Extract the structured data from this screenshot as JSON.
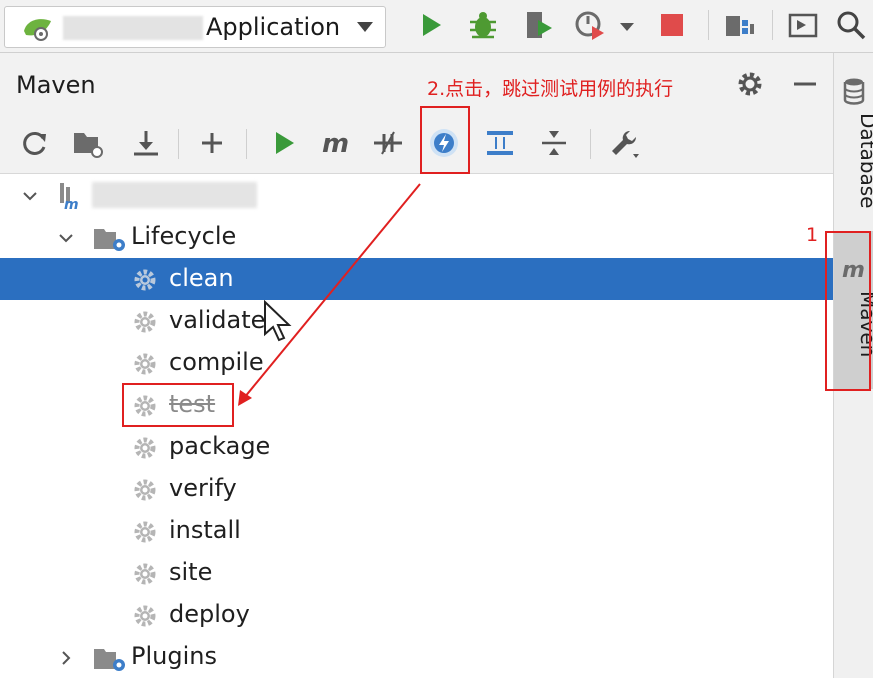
{
  "toolbar": {
    "run_config_name": "Application",
    "icons": [
      "spring-boot-icon",
      "run-icon",
      "debug-icon",
      "coverage-icon",
      "profile-icon",
      "dropdown-icon",
      "stop-icon",
      "project-structure-icon",
      "terminal-icon",
      "search-icon"
    ],
    "colors": {
      "run": "#3a9a3a",
      "debug": "#4e9a32",
      "stop": "#e04b4b"
    }
  },
  "panel": {
    "title": "Maven",
    "header_icons": [
      "gear-icon",
      "minimize-icon"
    ],
    "tools": [
      "reload-icon",
      "add-folder-icon",
      "download-icon",
      "plus-icon",
      "run-maven-icon",
      "execute-goal-icon",
      "toggle-offline-icon",
      "skip-tests-icon",
      "show-dependencies-icon",
      "collapse-all-icon",
      "settings-wrench-icon"
    ]
  },
  "tree": {
    "lifecycle_label": "Lifecycle",
    "plugins_label": "Plugins",
    "goals": [
      {
        "label": "clean",
        "selected": true,
        "skipped": false
      },
      {
        "label": "validate",
        "selected": false,
        "skipped": false
      },
      {
        "label": "compile",
        "selected": false,
        "skipped": false
      },
      {
        "label": "test",
        "selected": false,
        "skipped": true
      },
      {
        "label": "package",
        "selected": false,
        "skipped": false
      },
      {
        "label": "verify",
        "selected": false,
        "skipped": false
      },
      {
        "label": "install",
        "selected": false,
        "skipped": false
      },
      {
        "label": "site",
        "selected": false,
        "skipped": false
      },
      {
        "label": "deploy",
        "selected": false,
        "skipped": false
      }
    ],
    "selection_color": "#2b6fc0"
  },
  "right_strip": {
    "database_label": "Database",
    "maven_label": "Maven"
  },
  "annotations": {
    "step1": "1",
    "step2": "2.点击，跳过测试用例的执行",
    "color": "#e02020"
  }
}
